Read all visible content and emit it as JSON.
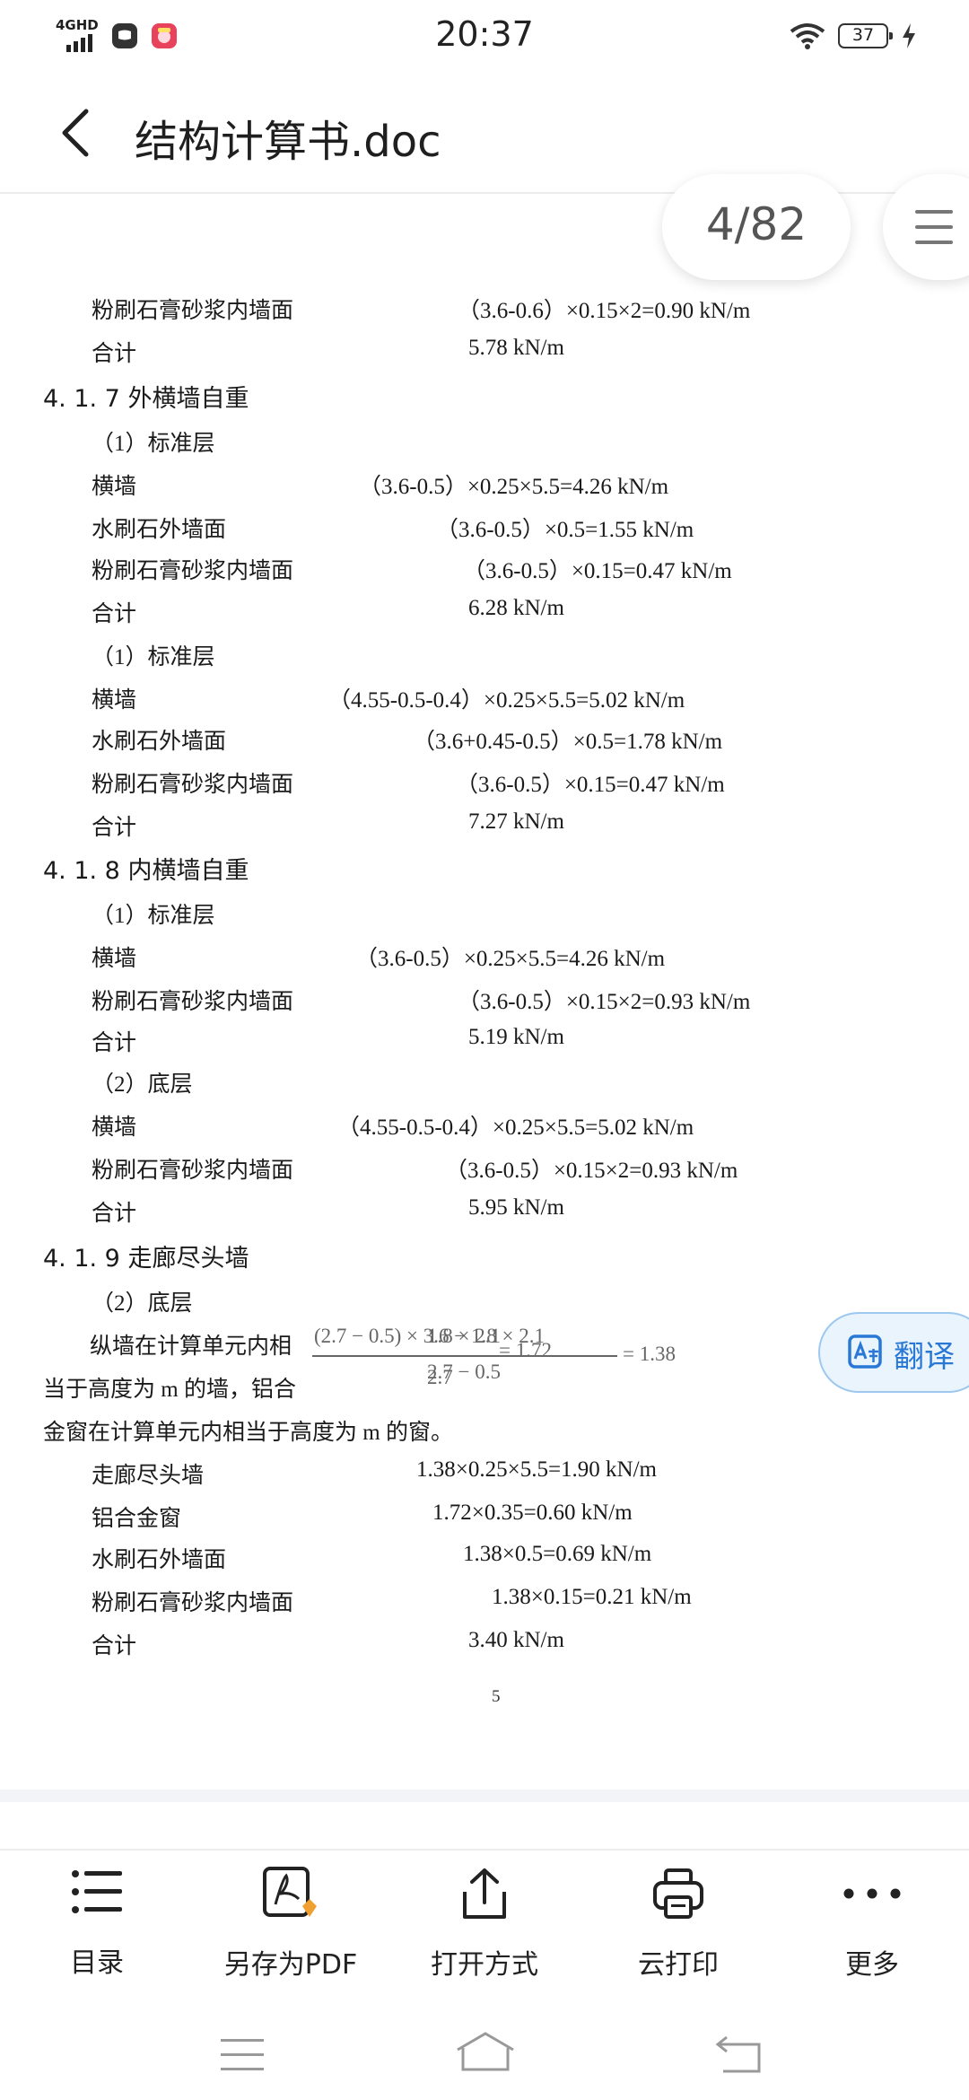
{
  "status_bar": {
    "network": "4GHD",
    "time": "20:37",
    "battery": "37"
  },
  "header": {
    "title": "结构计算书.doc"
  },
  "page_indicator": "4/82",
  "document": {
    "lines": [
      "粉刷石膏砂浆内墙面",
      "（3.6-0.6）×0.15×2=0.90 kN/m",
      "合计",
      "5.78 kN/m",
      "4. 1. 7  外横墙自重",
      "（1）标准层",
      "横墙",
      "（3.6-0.5）×0.25×5.5=4.26 kN/m",
      "水刷石外墙面",
      "（3.6-0.5）×0.5=1.55 kN/m",
      "粉刷石膏砂浆内墙面",
      "（3.6-0.5）×0.15=0.47 kN/m",
      "合计",
      "6.28 kN/m",
      "（1）标准层",
      "横墙",
      "（4.55-0.5-0.4）×0.25×5.5=5.02 kN/m",
      "水刷石外墙面",
      "（3.6+0.45-0.5）×0.5=1.78 kN/m",
      "粉刷石膏砂浆内墙面",
      "（3.6-0.5）×0.15=0.47 kN/m",
      "合计",
      "7.27 kN/m",
      "4. 1. 8  内横墙自重",
      "（1）标准层",
      "横墙",
      "（3.6-0.5）×0.25×5.5=4.26 kN/m",
      "粉刷石膏砂浆内墙面",
      "（3.6-0.5）×0.15×2=0.93 kN/m",
      "合计",
      "5.19 kN/m",
      "（2）底层",
      "横墙",
      "（4.55-0.5-0.4）×0.25×5.5=5.02 kN/m",
      "粉刷石膏砂浆内墙面",
      "（3.6-0.5）×0.15×2=0.93 kN/m",
      "合计",
      "5.95 kN/m",
      "4. 1. 9  走廊尽头墙",
      "（2）底层",
      "纵墙在计算单元内相",
      "当于高度为 m 的墙，铝合",
      "金窗在计算单元内相当于高度为 m 的窗。",
      "走廊尽头墙",
      "1.38×0.25×5.5=1.90 kN/m",
      "铝合金窗",
      "1.72×0.35=0.60 kN/m",
      "水刷石外墙面",
      "1.38×0.5=0.69 kN/m",
      "粉刷石膏砂浆内墙面",
      "1.38×0.15=0.21 kN/m",
      "合计",
      "3.40 kN/m",
      "5"
    ],
    "equation": {
      "num_a": "(2.7 − 0.5) × 3.6 − 1.8 × 2.1",
      "num_b": "1.8 × 2.1",
      "den_a": "2.7 − 0.5",
      "den_b": "2.7",
      "res_a": "= 1.38",
      "res_b": "= 1.72"
    }
  },
  "translate_button": "翻译",
  "toolbar": {
    "items": [
      "目录",
      "另存为PDF",
      "打开方式",
      "云打印",
      "更多"
    ]
  }
}
